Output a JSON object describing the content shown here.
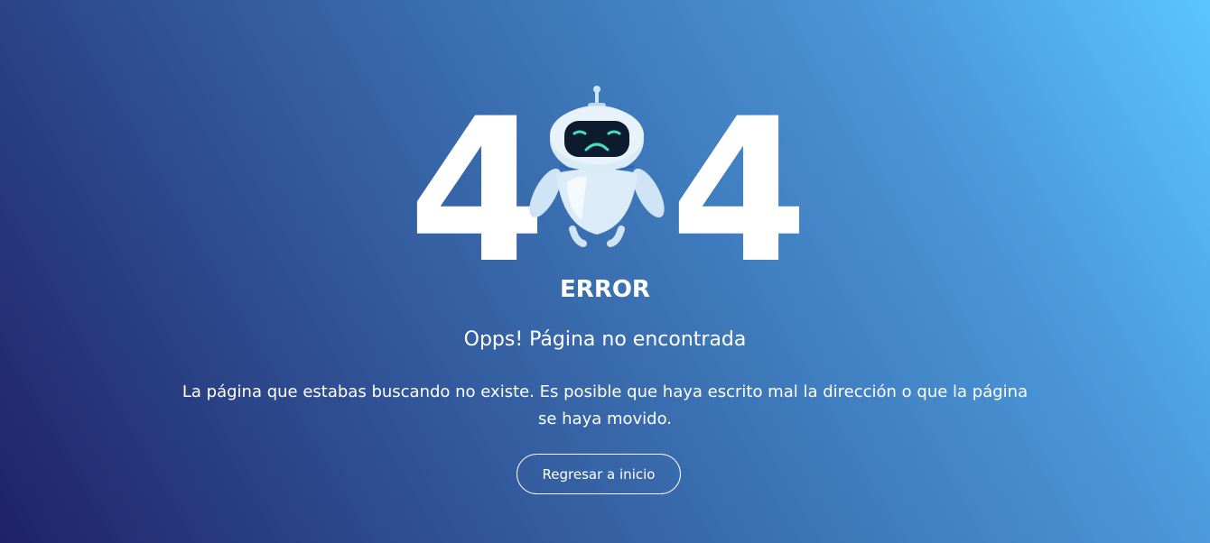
{
  "hero": {
    "digit_left": "4",
    "digit_right": "4"
  },
  "error": {
    "title": "ERROR",
    "subtitle": "Opps! Página no encontrada",
    "description": "La página que estabas buscando no existe. Es posible que haya escrito mal la dirección o que la página se haya movido."
  },
  "actions": {
    "home_button_label": "Regresar a inicio"
  },
  "illustration": {
    "icon": "sad-robot-icon"
  },
  "colors": {
    "gradient_start": "#1f2267",
    "gradient_end": "#5ac6fd",
    "text": "#ffffff"
  }
}
